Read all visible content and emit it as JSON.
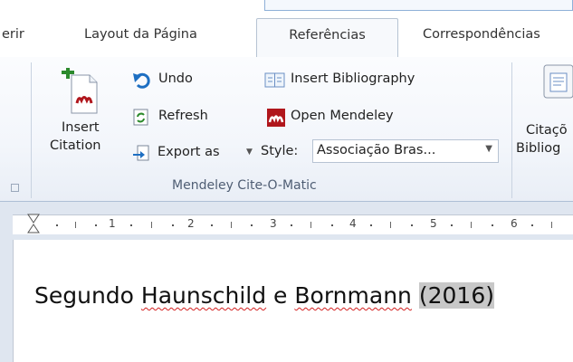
{
  "tabs": [
    {
      "label": "erir"
    },
    {
      "label": "Layout da Página"
    },
    {
      "label": "Referências",
      "active": true
    },
    {
      "label": "Correspondências"
    }
  ],
  "ribbon": {
    "insert_citation": {
      "line1": "Insert",
      "line2": "Citation"
    },
    "undo": "Undo",
    "refresh": "Refresh",
    "export_as": "Export as",
    "insert_bibliography": "Insert Bibliography",
    "open_mendeley": "Open Mendeley",
    "style_label": "Style:",
    "style_value": "Associação Bras...",
    "group_label": "Mendeley Cite-O-Matic",
    "citation_bib": {
      "line1": "Citaçõ",
      "line2": "Bibliog"
    }
  },
  "ruler": {
    "labels": [
      "1",
      "2",
      "3",
      "4",
      "5",
      "6"
    ]
  },
  "document": {
    "word1": "Segundo ",
    "author1": "Haunschild",
    "mid": " e ",
    "author2": "Bornmann",
    "space": " ",
    "citation": "(2016)"
  },
  "colors": {
    "mendeley_red": "#b0161c",
    "accent_blue": "#1e6fc2",
    "ribbon_border": "#aebfd6"
  }
}
